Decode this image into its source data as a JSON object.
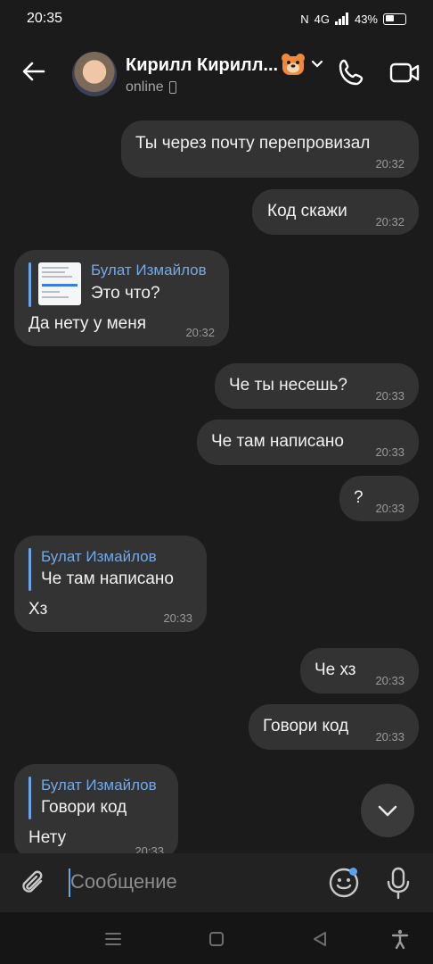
{
  "status_bar": {
    "time": "20:35",
    "network": "4G",
    "battery": "43%"
  },
  "header": {
    "contact_name": "Кирилл Кирилл...",
    "presence": "online",
    "icons": [
      "back-arrow-icon",
      "avatar",
      "bear-emoji-icon",
      "chevron-down-icon",
      "phone-icon",
      "video-camera-icon"
    ]
  },
  "messages": [
    {
      "direction": "out",
      "text": "Ты через почту перепровизал",
      "time": "20:32"
    },
    {
      "direction": "out",
      "text": "Код скажи",
      "time": "20:32"
    },
    {
      "direction": "in",
      "reply_author": "Булат Измайлов",
      "reply_text": "Это что?",
      "text": "Да нету у меня",
      "time": "20:32"
    },
    {
      "direction": "out",
      "text": "Че ты несешь?",
      "time": "20:33"
    },
    {
      "direction": "out",
      "text": "Че там написано",
      "time": "20:33"
    },
    {
      "direction": "out",
      "text": "?",
      "time": "20:33"
    },
    {
      "direction": "in",
      "reply_author": "Булат Измайлов",
      "reply_text": "Че там написано",
      "text": "Хз",
      "time": "20:33"
    },
    {
      "direction": "out",
      "text": "Че хз",
      "time": "20:33"
    },
    {
      "direction": "out",
      "text": "Говори код",
      "time": "20:33"
    },
    {
      "direction": "in",
      "reply_author": "Булат Измайлов",
      "reply_text": "Говори код",
      "text": "Нету",
      "time": "20:33"
    }
  ],
  "composer": {
    "placeholder": "Сообщение"
  },
  "colors": {
    "background": "#1b1b1b",
    "bubble": "#333334",
    "accent": "#74a9e4",
    "time": "#9a9a9a"
  }
}
